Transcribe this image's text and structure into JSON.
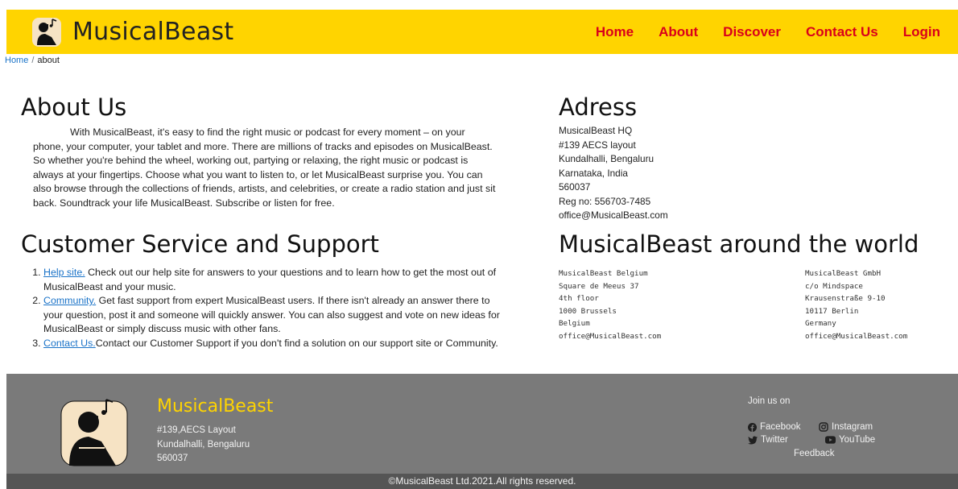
{
  "header": {
    "brand": "MusicalBeast",
    "nav": [
      "Home",
      "About",
      "Discover",
      "Contact Us",
      "Login"
    ]
  },
  "breadcrumb": {
    "home": "Home",
    "separator": "/",
    "current": "about"
  },
  "about": {
    "title": "About Us",
    "body": "With MusicalBeast, it's easy to find the right music or podcast for every moment – on your phone, your computer, your tablet and more. There are millions of tracks and episodes on MusicalBeast. So whether you're behind the wheel, working out, partying or relaxing, the right music or podcast is always at your fingertips. Choose what you want to listen to, or let MusicalBeast surprise you. You can also browse through the collections of friends, artists, and celebrities, or create a radio station and just sit back. Soundtrack your life MusicalBeast. Subscribe or listen for free."
  },
  "support": {
    "title": "Customer Service and Support",
    "items": [
      {
        "link": "Help site.",
        "text": " Check out our help site for answers to your questions and to learn how to get the most out of MusicalBeast and your music."
      },
      {
        "link": "Community.",
        "text": " Get fast support from expert MusicalBeast users. If there isn't already an answer there to your question, post it and someone will quickly answer. You can also suggest and vote on new ideas for MusicalBeast or simply discuss music with other fans."
      },
      {
        "link": "Contact Us.",
        "text": "Contact our Customer Support if you don't find a solution on our support site or Community."
      }
    ]
  },
  "address": {
    "title": "Adress",
    "lines": [
      "MusicalBeast HQ",
      "#139 AECS layout",
      "Kundalhalli, Bengaluru",
      "Karnataka, India",
      "560037",
      "Reg no: 556703-7485",
      "office@MusicalBeast.com"
    ]
  },
  "world": {
    "title": "MusicalBeast around the world",
    "offices": [
      {
        "lines": [
          "MusicalBeast Belgium",
          "Square de Meeus 37",
          "4th floor",
          "1000 Brussels",
          "Belgium",
          "office@MusicalBeast.com"
        ]
      },
      {
        "lines": [
          "MusicalBeast GmbH",
          "c/o Mindspace",
          "Krausenstraße 9-10",
          "10117 Berlin",
          "Germany",
          "office@MusicalBeast.com"
        ]
      }
    ]
  },
  "footer": {
    "brand": "MusicalBeast",
    "address_lines": [
      "#139,AECS Layout",
      "Kundalhalli, Bengaluru",
      "560037"
    ],
    "join": "Join us on",
    "social": [
      {
        "label": "Facebook",
        "icon": "facebook-icon"
      },
      {
        "label": "Instagram",
        "icon": "instagram-icon"
      },
      {
        "label": "Twitter",
        "icon": "twitter-icon"
      },
      {
        "label": "YouTube",
        "icon": "youtube-icon"
      }
    ],
    "feedback": "Feedback",
    "copyright": "©MusicalBeast Ltd.2021.All rights reserved."
  },
  "colors": {
    "header_bg": "#ffd400",
    "nav_link": "#d9001b",
    "link": "#1a73c8",
    "footer_bg": "#7a7a7a",
    "footer_brand": "#ffd400",
    "copyright_bg": "#555555"
  }
}
